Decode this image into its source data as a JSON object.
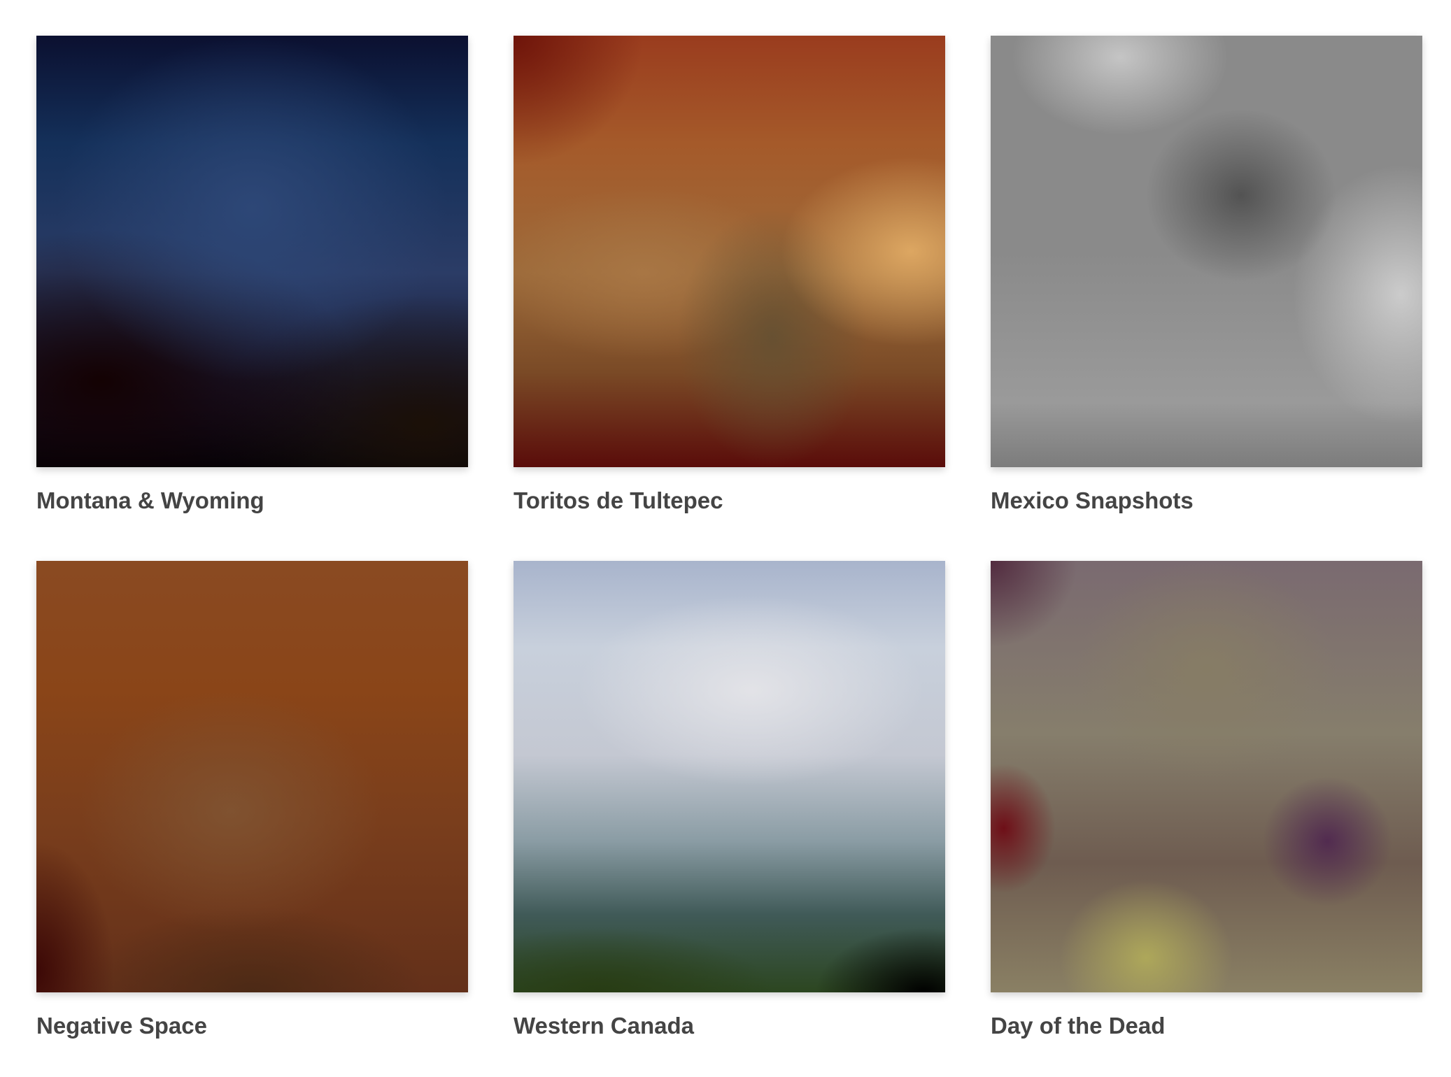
{
  "albums": [
    {
      "title": "Montana & Wyoming",
      "thumbnail": "blurred-photo"
    },
    {
      "title": "Toritos de Tultepec",
      "thumbnail": "blurred-photo"
    },
    {
      "title": "Mexico Snapshots",
      "thumbnail": "blurred-photo"
    },
    {
      "title": "Negative Space",
      "thumbnail": "blurred-photo"
    },
    {
      "title": "Western Canada",
      "thumbnail": "blurred-photo"
    },
    {
      "title": "Day of the Dead",
      "thumbnail": "blurred-photo"
    }
  ],
  "colors": {
    "background": "#ffffff",
    "title_text": "#444444"
  }
}
